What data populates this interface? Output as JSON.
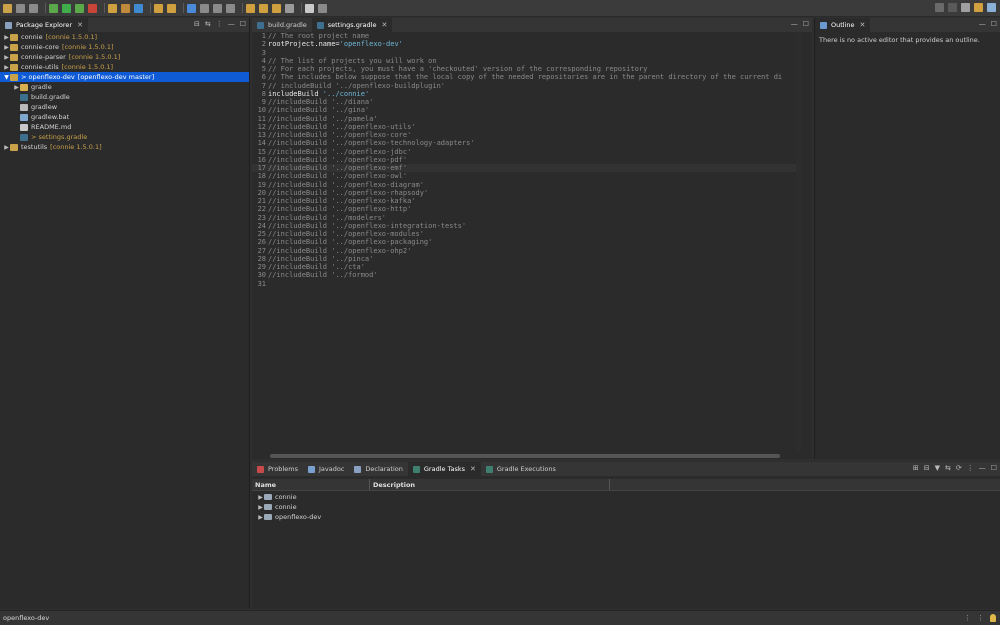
{
  "colors": {
    "selection": "#0f5bd6",
    "string": "#6fb8d8",
    "decoration": "#c8a04a",
    "comment": "#8a8a8a"
  },
  "explorer": {
    "tab_label": "Package Explorer",
    "items": [
      {
        "label": "connie",
        "decoration": "[connie 1.5.0.1]",
        "expanded": false,
        "level": 0,
        "icon": "gradle-project-icon"
      },
      {
        "label": "connie-core",
        "decoration": "[connie 1.5.0.1]",
        "expanded": false,
        "level": 0,
        "icon": "gradle-project-icon"
      },
      {
        "label": "connie-parser",
        "decoration": "[connie 1.5.0.1]",
        "expanded": false,
        "level": 0,
        "icon": "gradle-project-icon"
      },
      {
        "label": "connie-utils",
        "decoration": "[connie 1.5.0.1]",
        "expanded": false,
        "level": 0,
        "icon": "gradle-project-icon"
      },
      {
        "label": "> openflexo-dev",
        "decoration": "[openflexo-dev master]",
        "expanded": true,
        "level": 0,
        "icon": "gradle-project-icon",
        "selected": true
      },
      {
        "label": "gradle",
        "decoration": "",
        "expanded": false,
        "level": 1,
        "icon": "folder-icon"
      },
      {
        "label": "build.gradle",
        "decoration": "",
        "level": 1,
        "icon": "gradle-file-icon"
      },
      {
        "label": "gradlew",
        "decoration": "",
        "level": 1,
        "icon": "file-icon"
      },
      {
        "label": "gradlew.bat",
        "decoration": "",
        "level": 1,
        "icon": "bat-file-icon"
      },
      {
        "label": "README.md",
        "decoration": "",
        "level": 1,
        "icon": "markdown-file-icon"
      },
      {
        "label": "> settings.gradle",
        "decoration": "",
        "level": 1,
        "icon": "gradle-file-icon",
        "modified": true
      },
      {
        "label": "testutils",
        "decoration": "[connie 1.5.0.1]",
        "expanded": false,
        "level": 0,
        "icon": "gradle-project-icon"
      }
    ]
  },
  "editor": {
    "tabs": [
      {
        "label": "build.gradle",
        "active": false
      },
      {
        "label": "settings.gradle",
        "active": true
      }
    ],
    "lines": [
      {
        "n": "1",
        "text": "// The root project name",
        "type": "comment"
      },
      {
        "n": "2",
        "code": "rootProject.name=",
        "str": "'openflexo-dev'",
        "type": "code"
      },
      {
        "n": "3",
        "text": "",
        "type": "comment"
      },
      {
        "n": "4",
        "text": "// The list of projects you will work on",
        "type": "comment"
      },
      {
        "n": "5",
        "text": "// For each projects, you must have a 'checkouted' version of the corresponding repository",
        "type": "comment"
      },
      {
        "n": "6",
        "text": "// The includes below suppose that the local copy of the needed repositories are in the parent directory of the current di",
        "type": "comment"
      },
      {
        "n": "7",
        "text": "// includeBuild '../openflexo-buildplugin'",
        "type": "comment"
      },
      {
        "n": "8",
        "code": "includeBuild ",
        "str": "'../connie'",
        "type": "code"
      },
      {
        "n": "9",
        "text": "//includeBuild '../diana'",
        "type": "comment"
      },
      {
        "n": "10",
        "text": "//includeBuild '../gina'",
        "type": "comment"
      },
      {
        "n": "11",
        "text": "//includeBuild '../pamela'",
        "type": "comment"
      },
      {
        "n": "12",
        "text": "//includeBuild '../openflexo-utils'",
        "type": "comment"
      },
      {
        "n": "13",
        "text": "//includeBuild '../openflexo-core'",
        "type": "comment"
      },
      {
        "n": "14",
        "text": "//includeBuild '../openflexo-technology-adapters'",
        "type": "comment"
      },
      {
        "n": "15",
        "text": "//includeBuild '../openflexo-jdbc'",
        "type": "comment"
      },
      {
        "n": "16",
        "text": "//includeBuild '../openflexo-pdf'",
        "type": "comment"
      },
      {
        "n": "17",
        "text": "//includeBuild '../openflexo-emf'",
        "type": "comment",
        "current": true
      },
      {
        "n": "18",
        "text": "//includeBuild '../openflexo-owl'",
        "type": "comment"
      },
      {
        "n": "19",
        "text": "//includeBuild '../openflexo-diagram'",
        "type": "comment"
      },
      {
        "n": "20",
        "text": "//includeBuild '../openflexo-rhapsody'",
        "type": "comment"
      },
      {
        "n": "21",
        "text": "//includeBuild '../openflexo-kafka'",
        "type": "comment"
      },
      {
        "n": "22",
        "text": "//includeBuild '../openflexo-http'",
        "type": "comment"
      },
      {
        "n": "23",
        "text": "//includeBuild '../modelers'",
        "type": "comment"
      },
      {
        "n": "24",
        "text": "//includeBuild '../openflexo-integration-tests'",
        "type": "comment"
      },
      {
        "n": "25",
        "text": "//includeBuild '../openflexo-modules'",
        "type": "comment"
      },
      {
        "n": "26",
        "text": "//includeBuild '../openflexo-packaging'",
        "type": "comment"
      },
      {
        "n": "27",
        "text": "//includeBuild '../openflexo-ohp2'",
        "type": "comment"
      },
      {
        "n": "28",
        "text": "//includeBuild '../pinca'",
        "type": "comment"
      },
      {
        "n": "29",
        "text": "//includeBuild '../cta'",
        "type": "comment"
      },
      {
        "n": "30",
        "text": "//includeBuild '../formod'",
        "type": "comment"
      },
      {
        "n": "31",
        "text": "",
        "type": "comment"
      }
    ]
  },
  "outline": {
    "tab_label": "Outline",
    "message": "There is no active editor that provides an outline."
  },
  "bottom": {
    "tabs": [
      {
        "label": "Problems",
        "active": false,
        "icon": "problems-icon"
      },
      {
        "label": "Javadoc",
        "active": false,
        "icon": "javadoc-icon"
      },
      {
        "label": "Declaration",
        "active": false,
        "icon": "declaration-icon"
      },
      {
        "label": "Gradle Tasks",
        "active": true,
        "icon": "gradle-icon"
      },
      {
        "label": "Gradle Executions",
        "active": false,
        "icon": "gradle-icon"
      }
    ],
    "columns": [
      "Name",
      "Description"
    ],
    "rows": [
      "connie",
      "connie",
      "openflexo-dev"
    ]
  },
  "status": {
    "text": "openflexo-dev"
  }
}
